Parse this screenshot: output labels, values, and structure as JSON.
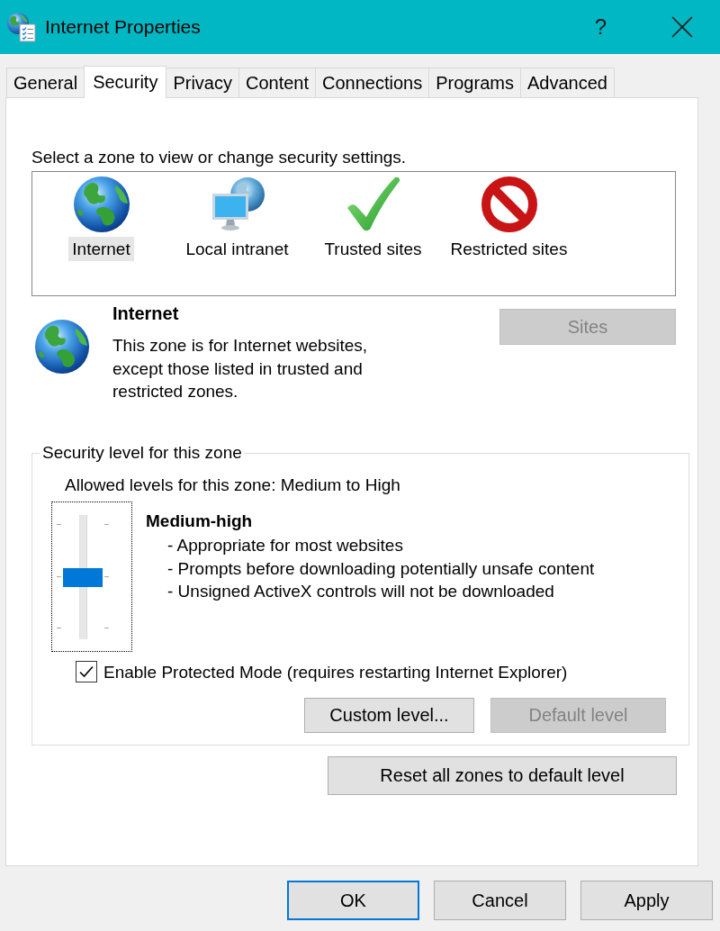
{
  "window": {
    "title": "Internet Properties",
    "help": "?"
  },
  "tabs": [
    {
      "label": "General",
      "selected": false
    },
    {
      "label": "Security",
      "selected": true
    },
    {
      "label": "Privacy",
      "selected": false
    },
    {
      "label": "Content",
      "selected": false
    },
    {
      "label": "Connections",
      "selected": false
    },
    {
      "label": "Programs",
      "selected": false
    },
    {
      "label": "Advanced",
      "selected": false
    }
  ],
  "security": {
    "prompt": "Select a zone to view or change security settings.",
    "zones": [
      {
        "label": "Internet",
        "kind": "globe",
        "selected": true
      },
      {
        "label": "Local intranet",
        "kind": "intranet",
        "selected": false
      },
      {
        "label": "Trusted sites",
        "kind": "trusted",
        "selected": false
      },
      {
        "label": "Restricted sites",
        "kind": "restricted",
        "selected": false
      }
    ],
    "zone_info": {
      "kind": "globe",
      "title": "Internet",
      "description_lines": [
        "This zone is for Internet websites,",
        "except those listed in trusted and",
        "restricted zones."
      ],
      "sites_button": {
        "label": "Sites",
        "disabled": true
      }
    },
    "level_group": {
      "legend": "Security level for this zone",
      "allowed": "Allowed levels for this zone: Medium to High",
      "slider": {
        "level": 0.5
      },
      "level_name": "Medium-high",
      "details": [
        "- Appropriate for most websites",
        "- Prompts before downloading potentially unsafe content",
        "- Unsigned ActiveX controls will not be downloaded"
      ],
      "protected_mode": {
        "label": "Enable Protected Mode (requires restarting Internet Explorer)",
        "checked": true
      },
      "buttons": [
        {
          "label": "Custom level...",
          "disabled": false
        },
        {
          "label": "Default level",
          "disabled": true
        }
      ]
    },
    "reset_button": {
      "label": "Reset all zones to default level",
      "disabled": false
    }
  },
  "dialog_buttons": [
    {
      "label": "OK",
      "default": true
    },
    {
      "label": "Cancel",
      "default": false
    },
    {
      "label": "Apply",
      "default": false
    }
  ]
}
